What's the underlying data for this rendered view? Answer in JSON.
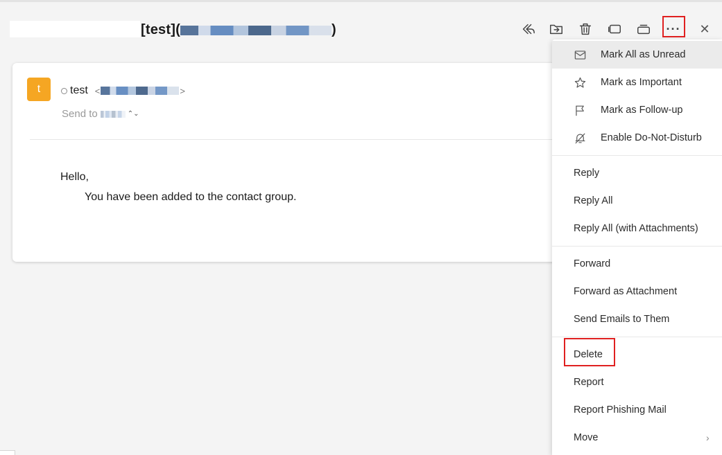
{
  "mail": {
    "subject_prefix": "[test](",
    "subject_suffix": ")",
    "sender_initial": "t",
    "sender_name": "test",
    "sender_email_open": "<",
    "sender_email_close": ">",
    "send_to_label": "Send to",
    "send_to_caret": "⌃⌄",
    "body_greeting": "Hello,",
    "body_text": "You have been added to the contact group."
  },
  "toolbar": {
    "icons": [
      "reply-all-icon",
      "move-icon",
      "delete-icon",
      "window-icon",
      "minimize-window-icon",
      "more-icon",
      "close-icon"
    ],
    "more_glyph": "···",
    "close_glyph": "✕"
  },
  "menu": {
    "group1": [
      {
        "label": "Mark All as Unread",
        "icon": "envelope-icon"
      },
      {
        "label": "Mark as Important",
        "icon": "star-icon"
      },
      {
        "label": "Mark as Follow-up",
        "icon": "flag-icon"
      },
      {
        "label": "Enable Do-Not-Disturb",
        "icon": "bell-off-icon"
      }
    ],
    "group2": [
      "Reply",
      "Reply All",
      "Reply All (with Attachments)"
    ],
    "group3": [
      "Forward",
      "Forward as Attachment",
      "Send Emails to Them"
    ],
    "group4": [
      "Delete",
      "Report",
      "Report Phishing Mail",
      "Move"
    ],
    "move_chevron": "›"
  },
  "colors": {
    "avatar": "#f5a623",
    "highlight_box": "#e02020",
    "menu_hover": "#ebebeb"
  }
}
